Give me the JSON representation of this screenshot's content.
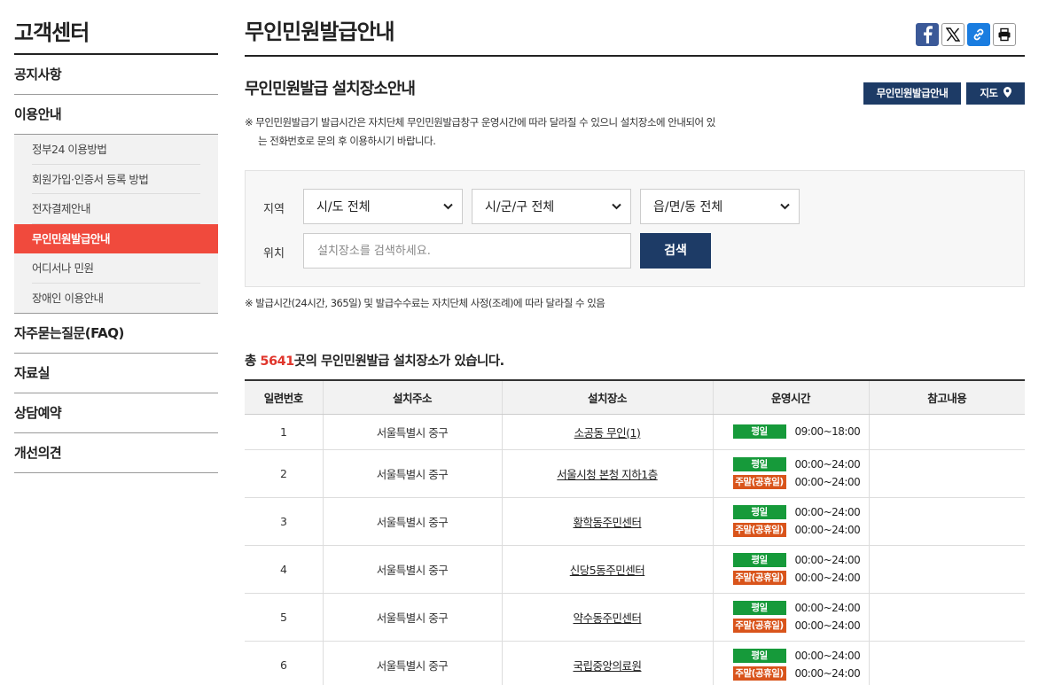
{
  "sidebar": {
    "title": "고객센터",
    "menu": [
      {
        "label": "공지사항"
      },
      {
        "label": "이용안내"
      }
    ],
    "sub_items": [
      {
        "label": "정부24 이용방법",
        "active": false
      },
      {
        "label": "회원가입·인증서 등록 방법",
        "active": false
      },
      {
        "label": "전자결제안내",
        "active": false
      },
      {
        "label": "무인민원발급안내",
        "active": true
      },
      {
        "label": "어디서나 민원",
        "active": false
      },
      {
        "label": "장애인 이용안내",
        "active": false
      }
    ],
    "menu_after": [
      {
        "label": "자주묻는질문(FAQ)"
      },
      {
        "label": "자료실"
      },
      {
        "label": "상담예약"
      },
      {
        "label": "개선의견"
      }
    ]
  },
  "header": {
    "title": "무인민원발급안내",
    "share_icons": [
      "facebook-icon",
      "x-icon",
      "link-icon",
      "print-icon"
    ]
  },
  "section": {
    "title": "무인민원발급 설치장소안내",
    "btn_guide": "무인민원발급안내",
    "btn_map": "지도",
    "note_line1": "※ 무인민원발급기 발급시간은 자치단체 무인민원발급창구 운영시간에 따라 달라질 수 있으니 설치장소에 안내되어 있",
    "note_line2": "는 전화번호로 문의 후 이용하시기 바랍니다."
  },
  "search": {
    "region_label": "지역",
    "location_label": "위치",
    "sido": "시/도 전체",
    "sigungu": "시/군/구 전체",
    "eupmyeondong": "읍/면/동 전체",
    "placeholder": "설치장소를 검색하세요.",
    "button": "검색"
  },
  "note2": "※ 발급시간(24시간, 365일) 및 발급수수료는 자치단체 사정(조례)에 따라 달라질 수 있음",
  "count": {
    "prefix": "총 ",
    "number": "5641",
    "suffix": "곳의 무인민원발급 설치장소가 있습니다."
  },
  "table": {
    "headers": [
      "일련번호",
      "설치주소",
      "설치장소",
      "운영시간",
      "참고내용"
    ],
    "weekday_label": "평일",
    "weekend_label": "주말(공휴일)",
    "rows": [
      {
        "no": "1",
        "addr": "서울특별시 중구",
        "place": "소공동 무인(1)",
        "weekday": "09:00~18:00",
        "weekend": ""
      },
      {
        "no": "2",
        "addr": "서울특별시 중구",
        "place": "서울시청 본청 지하1층",
        "weekday": "00:00~24:00",
        "weekend": "00:00~24:00"
      },
      {
        "no": "3",
        "addr": "서울특별시 중구",
        "place": "황학동주민센터",
        "weekday": "00:00~24:00",
        "weekend": "00:00~24:00"
      },
      {
        "no": "4",
        "addr": "서울특별시 중구",
        "place": "신당5동주민센터",
        "weekday": "00:00~24:00",
        "weekend": "00:00~24:00"
      },
      {
        "no": "5",
        "addr": "서울특별시 중구",
        "place": "약수동주민센터",
        "weekday": "00:00~24:00",
        "weekend": "00:00~24:00"
      },
      {
        "no": "6",
        "addr": "서울특별시 중구",
        "place": "국립중앙의료원",
        "weekday": "00:00~24:00",
        "weekend": "00:00~24:00"
      }
    ]
  },
  "colors": {
    "navy": "#1d3b66",
    "active_red": "#f04a3d",
    "weekday_green": "#169a3a",
    "weekend_orange": "#d9541b",
    "count_red": "#e0362c"
  }
}
